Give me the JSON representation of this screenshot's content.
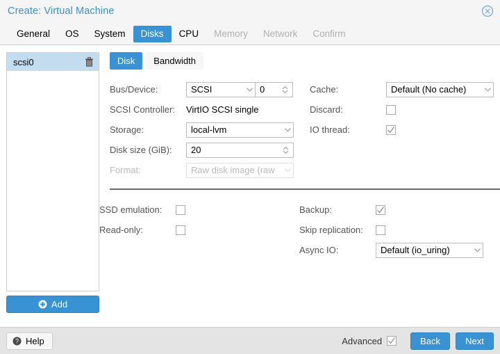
{
  "window": {
    "title": "Create: Virtual Machine",
    "close_icon": "close-circle-icon",
    "accent_color": "#3892d4",
    "selection_color": "#c4dcf0"
  },
  "tabs": [
    {
      "label": "General",
      "state": "enabled"
    },
    {
      "label": "OS",
      "state": "enabled"
    },
    {
      "label": "System",
      "state": "enabled"
    },
    {
      "label": "Disks",
      "state": "active"
    },
    {
      "label": "CPU",
      "state": "enabled"
    },
    {
      "label": "Memory",
      "state": "disabled"
    },
    {
      "label": "Network",
      "state": "disabled"
    },
    {
      "label": "Confirm",
      "state": "disabled"
    }
  ],
  "disk_list": {
    "items": [
      {
        "label": "scsi0",
        "selected": true,
        "delete_icon": "trash-icon"
      }
    ],
    "add_label": "Add",
    "add_icon": "plus-circle-icon"
  },
  "subtabs": [
    {
      "label": "Disk",
      "state": "active"
    },
    {
      "label": "Bandwidth",
      "state": "enabled"
    }
  ],
  "form": {
    "left": {
      "bus_device_label": "Bus/Device:",
      "bus_value": "SCSI",
      "device_value": "0",
      "scsi_controller_label": "SCSI Controller:",
      "scsi_controller_value": "VirtIO SCSI single",
      "storage_label": "Storage:",
      "storage_value": "local-lvm",
      "disk_size_label": "Disk size (GiB):",
      "disk_size_value": "20",
      "format_label": "Format:",
      "format_value": "Raw disk image (raw",
      "format_disabled": true
    },
    "right": {
      "cache_label": "Cache:",
      "cache_value": "Default (No cache)",
      "discard_label": "Discard:",
      "discard_checked": false,
      "io_thread_label": "IO thread:",
      "io_thread_checked": true
    },
    "lower_left": {
      "ssd_emulation_label": "SSD emulation:",
      "ssd_emulation_checked": false,
      "read_only_label": "Read-only:",
      "read_only_checked": false
    },
    "lower_right": {
      "backup_label": "Backup:",
      "backup_checked": true,
      "skip_replication_label": "Skip replication:",
      "skip_replication_checked": false,
      "async_io_label": "Async IO:",
      "async_io_value": "Default (io_uring)"
    }
  },
  "footer": {
    "help_label": "Help",
    "help_icon": "question-circle-icon",
    "advanced_label": "Advanced",
    "advanced_checked": true,
    "back_label": "Back",
    "next_label": "Next"
  }
}
